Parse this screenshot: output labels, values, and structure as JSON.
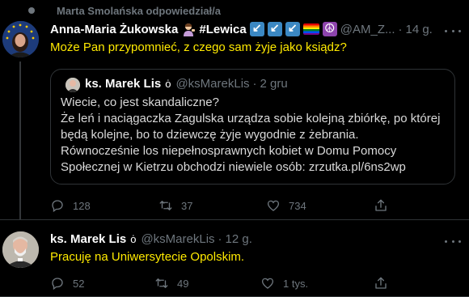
{
  "retweet_header": {
    "text": "Marta Smolańska odpowiedział/a"
  },
  "tweet1": {
    "author_name": "Anna-Maria Żukowska",
    "name_tag": "#Lewica",
    "handle": "@AM_Z...",
    "time": "14 g.",
    "text": "Może Pan przypomnieć, z czego sam żyje jako ksiądz?"
  },
  "quote": {
    "author_name": "ks. Marek Lis",
    "handle": "@ksMarekLis",
    "time": "2 gru",
    "lines": [
      "Wiecie, co jest skandaliczne?",
      "Że leń i naciągaczka Zagulska urządza sobie kolejną zbiórkę, po której",
      "będą kolejne, bo to dziewczę żyje wygodnie z żebrania.",
      "Równocześnie los niepełnosprawnych kobiet w Domu Pomocy",
      "Społecznej w Kietrzu obchodzi niewiele osób: zrzutka.pl/6ns2wp"
    ]
  },
  "tweet1_actions": {
    "reply_count": "128",
    "retweet_count": "37",
    "like_count": "734"
  },
  "tweet2": {
    "author_name": "ks. Marek Lis",
    "handle": "@ksMarekLis",
    "time": "12 g.",
    "text": "Pracuję na Uniwersytecie Opolskim."
  },
  "tweet2_actions": {
    "reply_count": "52",
    "retweet_count": "49",
    "like_count": "1 tys."
  },
  "colors": {
    "background": "#000000",
    "highlight_text": "#ffea00",
    "muted": "#6e767d",
    "name": "#ffffff"
  }
}
